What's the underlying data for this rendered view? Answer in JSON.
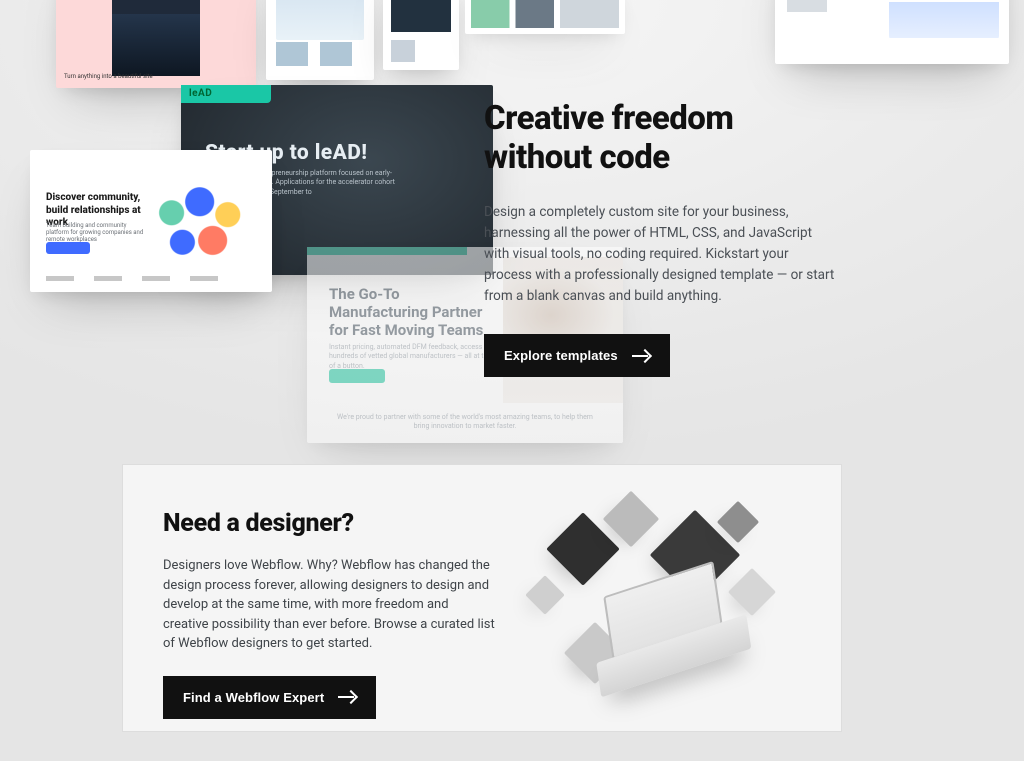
{
  "collage": {
    "c1_caption": "Turn anything into a beautiful site",
    "hero_card_title": "Start up to leAD!",
    "hero_card_sub": "leAD is a sports entrepreneurship platform focused on early-stage sports startups. Applications for the accelerator cohort will be in Berlin from September to",
    "ill_headline": "Discover community, build relationships at work",
    "ill_sub": "Team building and community platform for growing companies and remote workplaces",
    "mfg_headline": "The Go-To Manufacturing Partner for Fast Moving Teams",
    "mfg_sub": "Instant pricing, automated DFM feedback, access to hundreds of vetted global manufacturers — all at the click of a button.",
    "mfg_foot": "We're proud to partner with some of the world's most amazing teams, to help them bring innovation to market faster."
  },
  "hero": {
    "title_line1": "Creative freedom",
    "title_line2": "without code",
    "body": "Design a completely custom site for your business, harnessing all the power of HTML, CSS, and JavaScript with visual tools, no coding required. Kickstart your process with a professionally designed template — or start from a blank canvas and build anything.",
    "cta": "Explore templates"
  },
  "panel": {
    "title": "Need a designer?",
    "body": "Designers love Webflow. Why? Webflow has changed the design process forever, allowing designers to design and develop at the same time, with more freedom and creative possibility than ever before. Browse a curated list of Webflow designers to get started.",
    "cta": "Find a Webflow Expert"
  }
}
